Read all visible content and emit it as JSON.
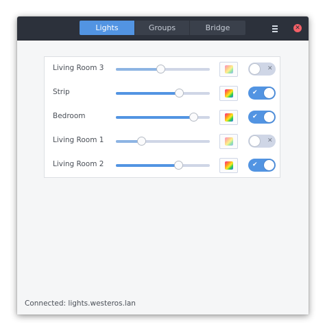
{
  "header": {
    "tabs": [
      {
        "label": "Lights",
        "active": true
      },
      {
        "label": "Groups",
        "active": false
      },
      {
        "label": "Bridge",
        "active": false
      }
    ],
    "menu_icon": "hamburger-menu-icon",
    "close_icon": "close-icon",
    "close_glyph": "✕"
  },
  "lights": [
    {
      "name": "Living Room 3",
      "brightness": 0.48,
      "on": false,
      "switch_glyph": "✕"
    },
    {
      "name": "Strip",
      "brightness": 0.68,
      "on": true,
      "switch_glyph": "✔"
    },
    {
      "name": "Bedroom",
      "brightness": 0.83,
      "on": true,
      "switch_glyph": "✔"
    },
    {
      "name": "Living Room 1",
      "brightness": 0.28,
      "on": false,
      "switch_glyph": "✕"
    },
    {
      "name": "Living Room 2",
      "brightness": 0.67,
      "on": true,
      "switch_glyph": "✔"
    }
  ],
  "status": {
    "text": "Connected: lights.westeros.lan"
  },
  "colors": {
    "accent": "#5294e2",
    "headerbar": "#2c313b",
    "close": "#f46067",
    "trough": "#cfd6e6"
  }
}
